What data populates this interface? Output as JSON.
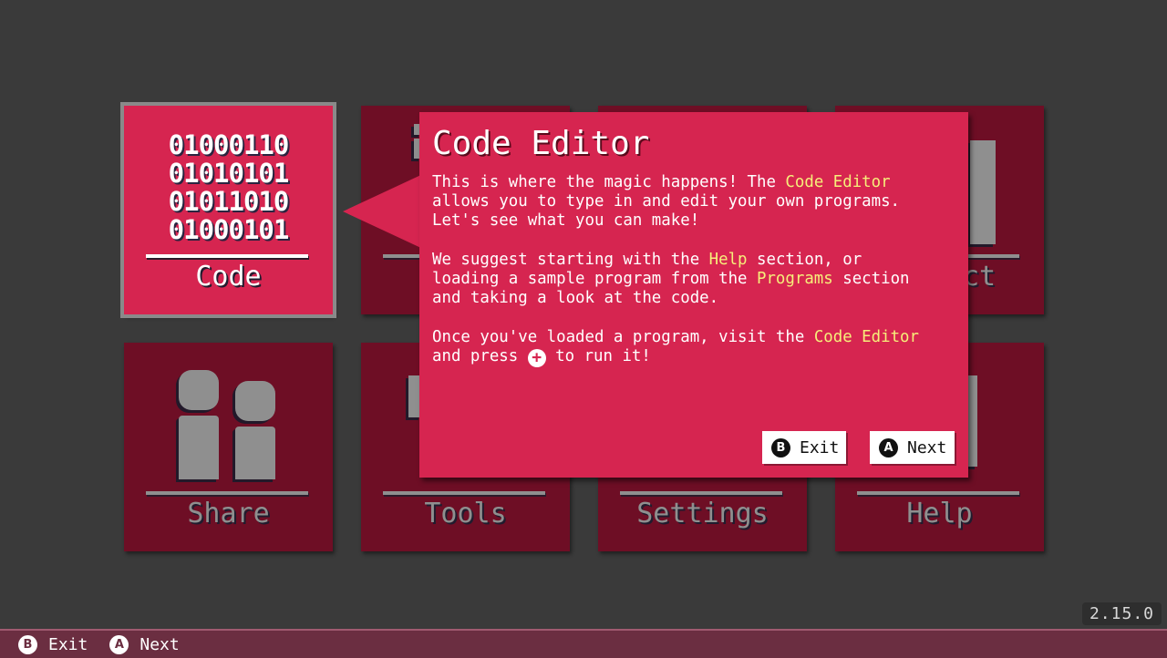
{
  "tiles": [
    {
      "label": "Code",
      "binary": [
        "01000110",
        "01010101",
        "01011010",
        "01000101"
      ],
      "selected": true
    },
    {
      "label": "",
      "selected": false
    },
    {
      "label": "",
      "selected": false
    },
    {
      "label": "ct",
      "selected": false
    },
    {
      "label": "Share",
      "selected": false
    },
    {
      "label": "Tools",
      "selected": false
    },
    {
      "label": "Settings",
      "selected": false
    },
    {
      "label": "Help",
      "selected": false
    }
  ],
  "tooltip": {
    "title": "Code Editor",
    "p1_a": "This is where the magic happens! The ",
    "p1_hl": "Code Editor",
    "p1_b": "\nallows you to type in and edit your own programs.\nLet's see what you can make!\n\nWe suggest starting with the ",
    "p2_hl1": "Help",
    "p2_b": " section, or\nloading a sample program from the ",
    "p2_hl2": "Programs",
    "p2_c": " section\nand taking a look at the code.\n\nOnce you've loaded a program, visit the ",
    "p3_hl": "Code Editor",
    "p3_b": "\nand press ",
    "plus_glyph": "+",
    "p3_c": " to run it!",
    "exit_badge": "B",
    "exit_label": "Exit",
    "next_badge": "A",
    "next_label": "Next"
  },
  "footer": {
    "exit_badge": "B",
    "exit_label": "Exit",
    "next_badge": "A",
    "next_label": "Next"
  },
  "version": "2.15.0",
  "colors": {
    "accent": "#d62550",
    "tile_dim": "#6e0e25",
    "highlight": "#f6ef7a",
    "footer": "#6b2e41"
  }
}
